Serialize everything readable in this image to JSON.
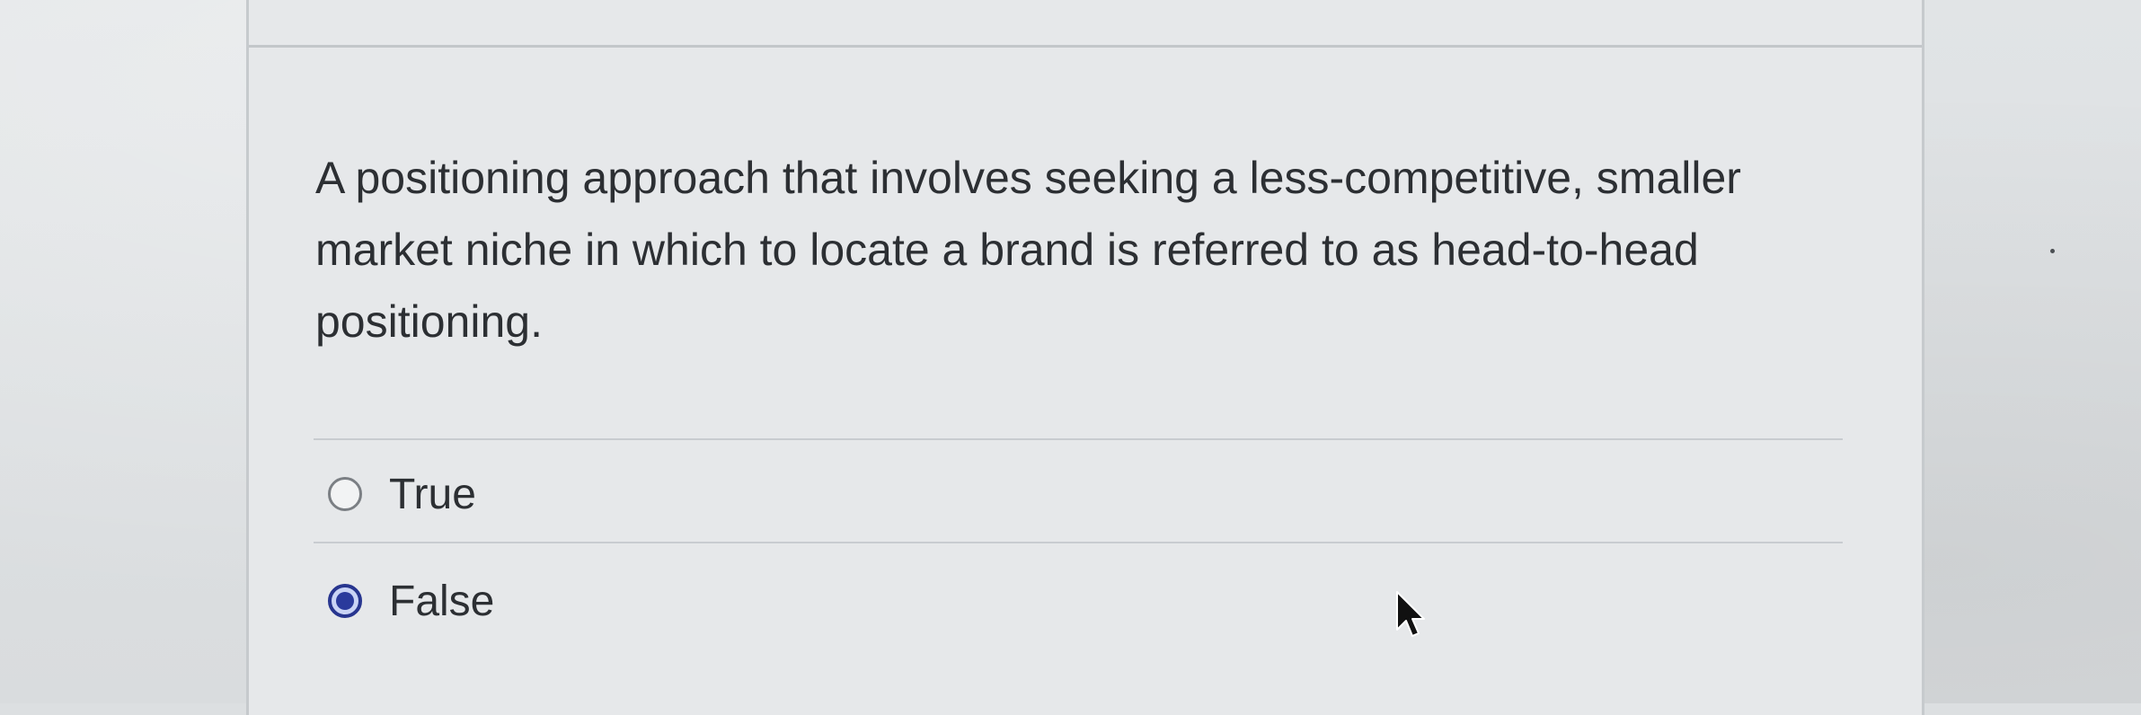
{
  "question": {
    "text": "A positioning approach that involves seeking a less-competitive, smaller market niche in which to locate a brand is referred to as head-to-head positioning."
  },
  "options": [
    {
      "label": "True",
      "selected": false
    },
    {
      "label": "False",
      "selected": true
    }
  ],
  "colors": {
    "text": "#2c2f33",
    "radio_selected": "#2a3a9c",
    "panel_background": "#e6e8ea",
    "page_background": "#dcdfe1"
  },
  "icons": {
    "cursor": "arrow-pointer-icon"
  }
}
